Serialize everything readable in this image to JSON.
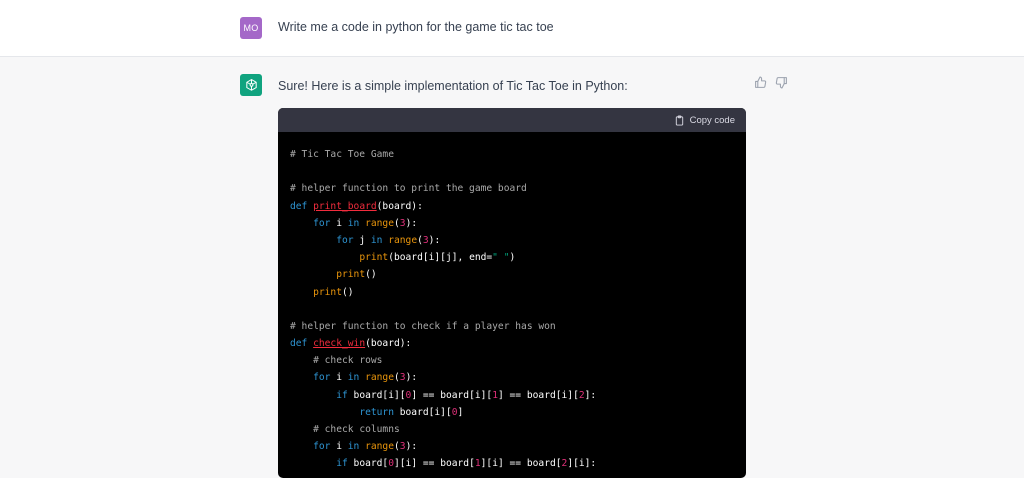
{
  "user_message": {
    "avatar_initials": "MO",
    "text": "Write me a code in python for the game tic tac toe"
  },
  "assistant_message": {
    "text": "Sure! Here is a simple implementation of Tic Tac Toe in Python:",
    "feedback": {
      "up_icon": "thumbs-up-icon",
      "down_icon": "thumbs-down-icon"
    }
  },
  "code_block": {
    "copy_label": "Copy code",
    "lines": [
      [
        [
          "comment",
          "# Tic Tac Toe Game"
        ]
      ],
      [],
      [
        [
          "comment",
          "# helper function to print the game board"
        ]
      ],
      [
        [
          "keyword",
          "def "
        ],
        [
          "fname",
          "print_board"
        ],
        [
          "plain",
          "(board):"
        ]
      ],
      [
        [
          "plain",
          "    "
        ],
        [
          "keyword",
          "for"
        ],
        [
          "plain",
          " i "
        ],
        [
          "keyword",
          "in"
        ],
        [
          "plain",
          " "
        ],
        [
          "builtin",
          "range"
        ],
        [
          "plain",
          "("
        ],
        [
          "num",
          "3"
        ],
        [
          "plain",
          "):"
        ]
      ],
      [
        [
          "plain",
          "        "
        ],
        [
          "keyword",
          "for"
        ],
        [
          "plain",
          " j "
        ],
        [
          "keyword",
          "in"
        ],
        [
          "plain",
          " "
        ],
        [
          "builtin",
          "range"
        ],
        [
          "plain",
          "("
        ],
        [
          "num",
          "3"
        ],
        [
          "plain",
          "):"
        ]
      ],
      [
        [
          "plain",
          "            "
        ],
        [
          "builtin",
          "print"
        ],
        [
          "plain",
          "(board[i][j], end="
        ],
        [
          "str",
          "\" \""
        ],
        [
          "plain",
          ")"
        ]
      ],
      [
        [
          "plain",
          "        "
        ],
        [
          "builtin",
          "print"
        ],
        [
          "plain",
          "()"
        ]
      ],
      [
        [
          "plain",
          "    "
        ],
        [
          "builtin",
          "print"
        ],
        [
          "plain",
          "()"
        ]
      ],
      [],
      [
        [
          "comment",
          "# helper function to check if a player has won"
        ]
      ],
      [
        [
          "keyword",
          "def "
        ],
        [
          "fname",
          "check_win"
        ],
        [
          "plain",
          "(board):"
        ]
      ],
      [
        [
          "plain",
          "    "
        ],
        [
          "comment",
          "# check rows"
        ]
      ],
      [
        [
          "plain",
          "    "
        ],
        [
          "keyword",
          "for"
        ],
        [
          "plain",
          " i "
        ],
        [
          "keyword",
          "in"
        ],
        [
          "plain",
          " "
        ],
        [
          "builtin",
          "range"
        ],
        [
          "plain",
          "("
        ],
        [
          "num",
          "3"
        ],
        [
          "plain",
          "):"
        ]
      ],
      [
        [
          "plain",
          "        "
        ],
        [
          "keyword",
          "if"
        ],
        [
          "plain",
          " board[i]["
        ],
        [
          "num",
          "0"
        ],
        [
          "plain",
          "] == board[i]["
        ],
        [
          "num",
          "1"
        ],
        [
          "plain",
          "] == board[i]["
        ],
        [
          "num",
          "2"
        ],
        [
          "plain",
          "]:"
        ]
      ],
      [
        [
          "plain",
          "            "
        ],
        [
          "keyword",
          "return"
        ],
        [
          "plain",
          " board[i]["
        ],
        [
          "num",
          "0"
        ],
        [
          "plain",
          "]"
        ]
      ],
      [
        [
          "plain",
          "    "
        ],
        [
          "comment",
          "# check columns"
        ]
      ],
      [
        [
          "plain",
          "    "
        ],
        [
          "keyword",
          "for"
        ],
        [
          "plain",
          " i "
        ],
        [
          "keyword",
          "in"
        ],
        [
          "plain",
          " "
        ],
        [
          "builtin",
          "range"
        ],
        [
          "plain",
          "("
        ],
        [
          "num",
          "3"
        ],
        [
          "plain",
          "):"
        ]
      ],
      [
        [
          "plain",
          "        "
        ],
        [
          "keyword",
          "if"
        ],
        [
          "plain",
          " board["
        ],
        [
          "num",
          "0"
        ],
        [
          "plain",
          "][i] == board["
        ],
        [
          "num",
          "1"
        ],
        [
          "plain",
          "][i] == board["
        ],
        [
          "num",
          "2"
        ],
        [
          "plain",
          "][i]:"
        ]
      ]
    ]
  },
  "colors": {
    "user_avatar": "#a468c8",
    "bot_avatar": "#10a37f",
    "code_bg": "#000000",
    "code_header_bg": "#343541"
  }
}
